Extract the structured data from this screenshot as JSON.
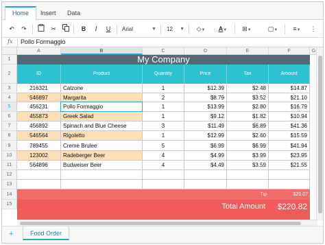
{
  "ribbon": {
    "tabs": [
      {
        "label": "Home",
        "active": true
      },
      {
        "label": "Insert",
        "active": false
      },
      {
        "label": "Data",
        "active": false
      }
    ]
  },
  "toolbar": {
    "undo_icon": "undo-icon",
    "redo_icon": "redo-icon",
    "font_family": "Arial",
    "font_size": "12",
    "bold": "B",
    "italic": "I",
    "underline": "U"
  },
  "formula_bar": {
    "fx_label": "fx",
    "value": "Pollo Formaggio"
  },
  "columns": [
    "A",
    "B",
    "C",
    "D",
    "E",
    "F",
    "G"
  ],
  "selected_column": "B",
  "rows": [
    "1",
    "2",
    "3",
    "4",
    "5",
    "6",
    "7",
    "8",
    "9",
    "10",
    "11",
    "12",
    "13",
    "14",
    "15"
  ],
  "selected_row": "5",
  "sheet": {
    "title": "My Company",
    "headers": [
      "ID",
      "Product",
      "Quantity",
      "Price",
      "Tax",
      "Amount"
    ],
    "data": [
      {
        "id": "216321",
        "product": "Calzone",
        "qty": "1",
        "price": "$12.39",
        "tax": "$2.48",
        "amount": "$14.87",
        "highlight": false
      },
      {
        "id": "546897",
        "product": "Margarita",
        "qty": "2",
        "price": "$8.79",
        "tax": "$3.52",
        "amount": "$21.10",
        "highlight": true
      },
      {
        "id": "456231",
        "product": "Pollo Formaggio",
        "qty": "1",
        "price": "$13.99",
        "tax": "$2.80",
        "amount": "$16.79",
        "highlight": false
      },
      {
        "id": "455873",
        "product": "Greek Salad",
        "qty": "1",
        "price": "$9.12",
        "tax": "$1.82",
        "amount": "$10.94",
        "highlight": true
      },
      {
        "id": "456892",
        "product": "Spinach and Blue Cheese",
        "qty": "3",
        "price": "$11.49",
        "tax": "$6.89",
        "amount": "$41.36",
        "highlight": false
      },
      {
        "id": "546564",
        "product": "Rigoletto",
        "qty": "1",
        "price": "$12.99",
        "tax": "$2.60",
        "amount": "$15.59",
        "highlight": true
      },
      {
        "id": "789455",
        "product": "Creme Brulee",
        "qty": "5",
        "price": "$6.99",
        "tax": "$6.99",
        "amount": "$41.94",
        "highlight": false
      },
      {
        "id": "123002",
        "product": "Radeberger Beer",
        "qty": "4",
        "price": "$4.99",
        "tax": "$3.99",
        "amount": "$23.95",
        "highlight": true
      },
      {
        "id": "564896",
        "product": "Budweiser Beer",
        "qty": "4",
        "price": "$4.49",
        "tax": "$3.59",
        "amount": "$21.55",
        "highlight": false
      }
    ],
    "tip_label": "Tip",
    "tip_value": "$20.07",
    "total_label": "Total Amount",
    "total_value": "$220.82"
  },
  "sheet_tabs": [
    {
      "label": "Food Order",
      "active": true
    }
  ],
  "colors": {
    "title_bg": "#566873",
    "header_bg": "#2ec2d1",
    "highlight_bg": "#fde0b8",
    "total_bg": "#ef5b5b",
    "accent": "#2aa7c7"
  }
}
